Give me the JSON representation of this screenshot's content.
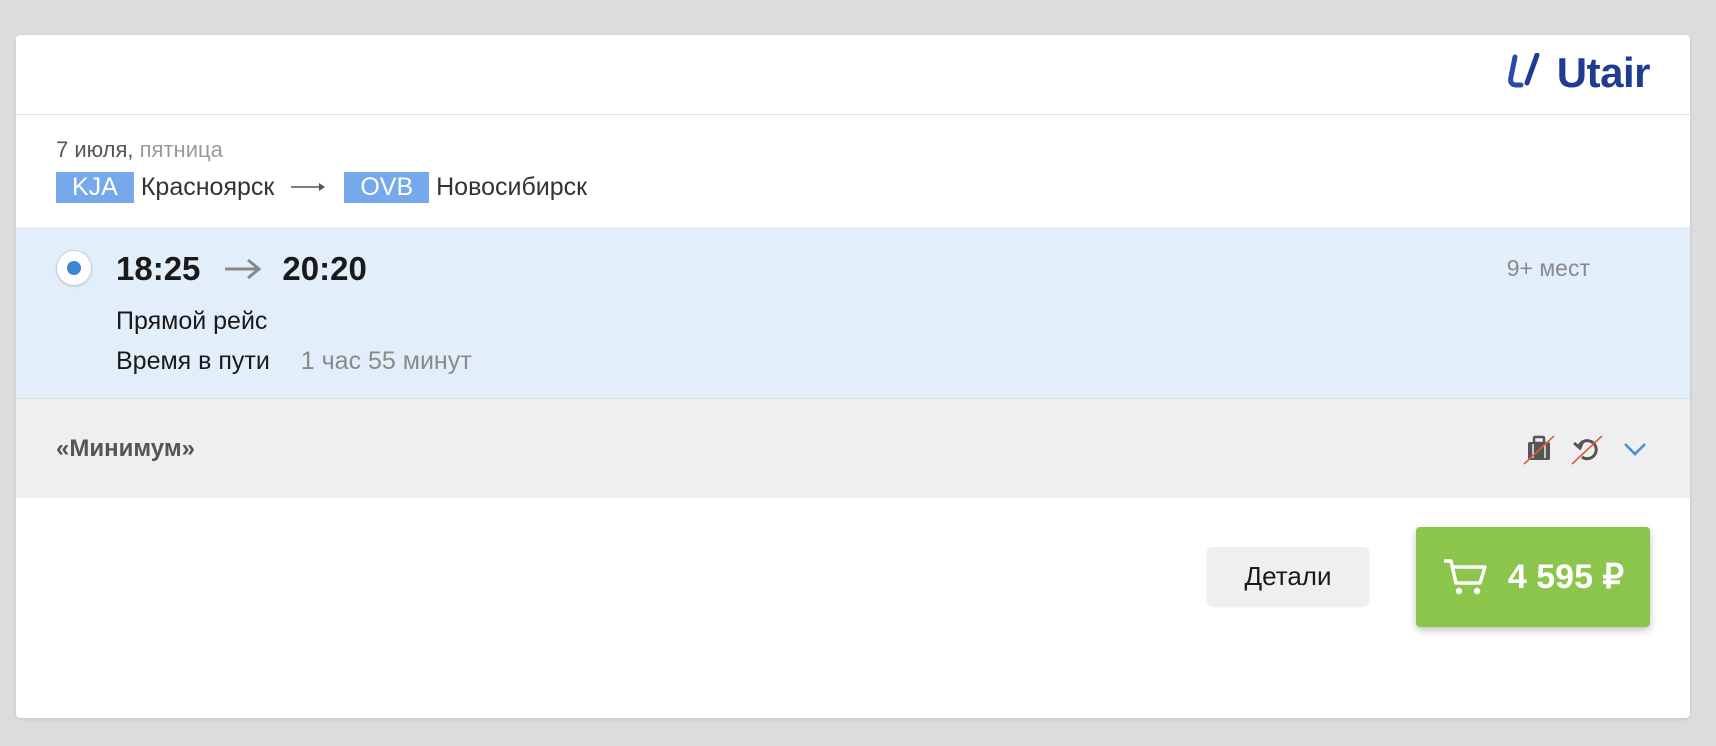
{
  "header": {
    "logo_text": "Utair"
  },
  "route": {
    "date": "7 июля,",
    "weekday": "пятница",
    "from_code": "KJA",
    "from_city": "Красноярск",
    "to_code": "OVB",
    "to_city": "Новосибирск"
  },
  "flight": {
    "selected": true,
    "departure_time": "18:25",
    "arrival_time": "20:20",
    "seats": "9+ мест",
    "type": "Прямой рейс",
    "duration_label": "Время в пути",
    "duration_value": "1 час 55 минут"
  },
  "tariff": {
    "name": "«Минимум»",
    "icons": [
      "baggage-not-included-icon",
      "refund-not-available-icon",
      "chevron-down-icon"
    ]
  },
  "actions": {
    "details_label": "Детали",
    "price": "4 595 ₽"
  },
  "colors": {
    "brand": "#1f3c93",
    "code_badge": "#76a9ec",
    "selected_row": "#e3eefb",
    "buy_button": "#8cc54b",
    "chevron": "#4a8fd9"
  }
}
